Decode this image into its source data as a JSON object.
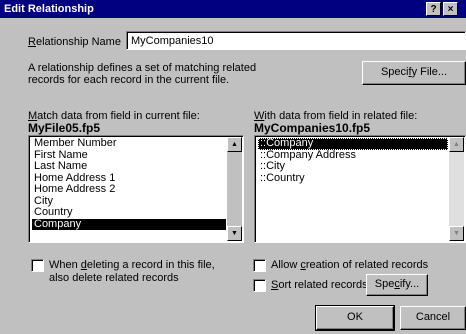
{
  "window": {
    "title": "Edit Relationship",
    "help_glyph": "?",
    "close_glyph": "×"
  },
  "relationship_name": {
    "label_prefix": "R",
    "label_rest": "elationship Name",
    "value": "MyCompanies10"
  },
  "description": {
    "line1": "A relationship defines a set of matching related",
    "line2": "records for each record in the current file."
  },
  "specify_file_button": {
    "before": "Speci",
    "accel": "f",
    "after": "y File..."
  },
  "left": {
    "label_prefix": "M",
    "label_rest": "atch data from field in current file:",
    "file": "MyFile05.fp5",
    "items": [
      "Member Number",
      "First Name",
      "Last Name",
      "Home Address 1",
      "Home Address 2",
      "City",
      "Country",
      "Company"
    ],
    "selected": "Company"
  },
  "right": {
    "label_prefix": "W",
    "label_rest": "ith data from field in related file:",
    "file": "MyCompanies10.fp5",
    "items": [
      "::Company",
      "::Company Address",
      "::City",
      "::Country"
    ],
    "selected": "::Company"
  },
  "options": {
    "delete_line1_pre": "When ",
    "delete_line1_accel": "d",
    "delete_line1_post": "eleting a record in this file,",
    "delete_line2": "also delete related records",
    "delete_checked": false,
    "allow_pre": "Allow ",
    "allow_accel": "c",
    "allow_post": "reation of related records",
    "allow_checked": false,
    "sort_accel": "S",
    "sort_post": "ort related records",
    "sort_checked": false
  },
  "specify_button": {
    "before": "Spe",
    "accel": "c",
    "after": "ify..."
  },
  "ok_button": "OK",
  "cancel_button": "Cancel",
  "scroll_up_glyph": "▲",
  "scroll_down_glyph": "▼"
}
